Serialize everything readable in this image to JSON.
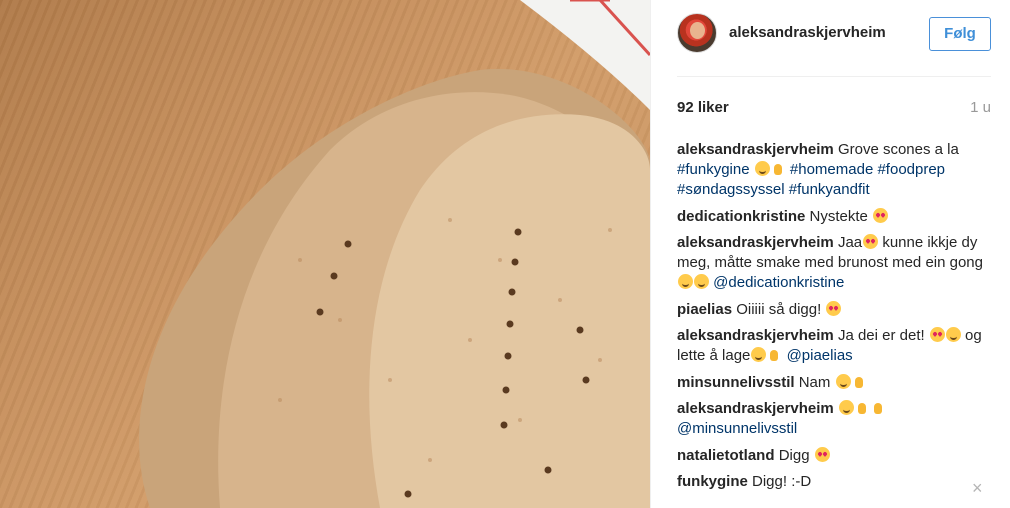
{
  "header": {
    "username": "aleksandraskjervheim",
    "follow_label": "Følg"
  },
  "stats": {
    "likes": "92 liker",
    "time": "1 u"
  },
  "comments": [
    {
      "user": "aleksandraskjervheim",
      "text": "Grove scones a la"
    },
    {
      "user": "dedicationkristine",
      "text": "Nystekte"
    },
    {
      "user": "aleksandraskjervheim",
      "text": "Jaa"
    },
    {
      "user": "piaelias",
      "text": "Oiiiii så digg!"
    },
    {
      "user": "aleksandraskjervheim",
      "text": "Ja dei er det!"
    },
    {
      "user": "minsunnelivsstil",
      "text": "Nam"
    },
    {
      "user": "aleksandraskjervheim",
      "text": ""
    },
    {
      "user": "natalietotland",
      "text": "Digg"
    },
    {
      "user": "funkygine",
      "text": "Digg! :-D"
    }
  ],
  "caption_extra": {
    "tag1": "#funkygine",
    "tag2": "#homemade",
    "tag3": "#foodprep",
    "tag4": "#søndagssyssel",
    "tag5": "#funkyandfit"
  },
  "reply_extra": {
    "c3_rest": "kunne ikkje dy meg, måtte smake med brunost med ein gong",
    "c3_mention": "@dedicationkristine",
    "c5_rest": "og lette å lage",
    "c5_mention": "@piaelias",
    "c7_mention": "@minsunnelivsstil"
  },
  "icons": {
    "close": "×"
  },
  "colors": {
    "link": "#003569",
    "follow_blue": "#3f8fd8"
  }
}
